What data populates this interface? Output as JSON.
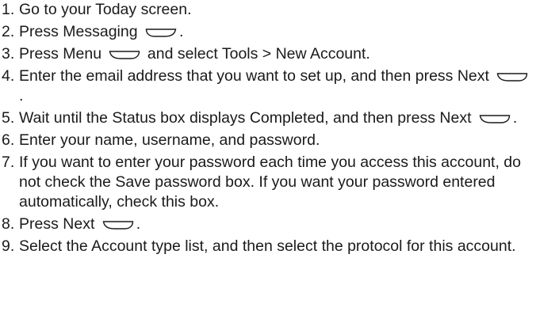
{
  "steps": [
    {
      "num": "1.",
      "parts": [
        {
          "text": "Go to your Today screen."
        }
      ]
    },
    {
      "num": "2.",
      "parts": [
        {
          "text": "Press Messaging "
        },
        {
          "icon": "softkey-right-icon"
        },
        {
          "text": "."
        }
      ]
    },
    {
      "num": "3.",
      "parts": [
        {
          "text": "Press Menu "
        },
        {
          "icon": "softkey-left-icon"
        },
        {
          "text": " and select Tools > New Account."
        }
      ]
    },
    {
      "num": "4.",
      "parts": [
        {
          "text": "Enter the email address that you want to set up, and then press Next "
        },
        {
          "icon": "softkey-left-icon"
        },
        {
          "text": "."
        }
      ]
    },
    {
      "num": "5.",
      "parts": [
        {
          "text": "Wait until the Status box displays Completed, and then press Next "
        },
        {
          "icon": "softkey-left-icon"
        },
        {
          "text": "."
        }
      ]
    },
    {
      "num": "6.",
      "parts": [
        {
          "text": "Enter your name, username, and password."
        }
      ]
    },
    {
      "num": "7.",
      "parts": [
        {
          "text": "If you want to enter your password each time you access this account, do not check the Save password box. If you want your password entered automatically, check this box."
        }
      ]
    },
    {
      "num": "8.",
      "parts": [
        {
          "text": "Press Next "
        },
        {
          "icon": "softkey-left-icon"
        },
        {
          "text": "."
        }
      ]
    },
    {
      "num": "9.",
      "parts": [
        {
          "text": "Select the Account type list, and then select the protocol for this account."
        }
      ]
    }
  ]
}
